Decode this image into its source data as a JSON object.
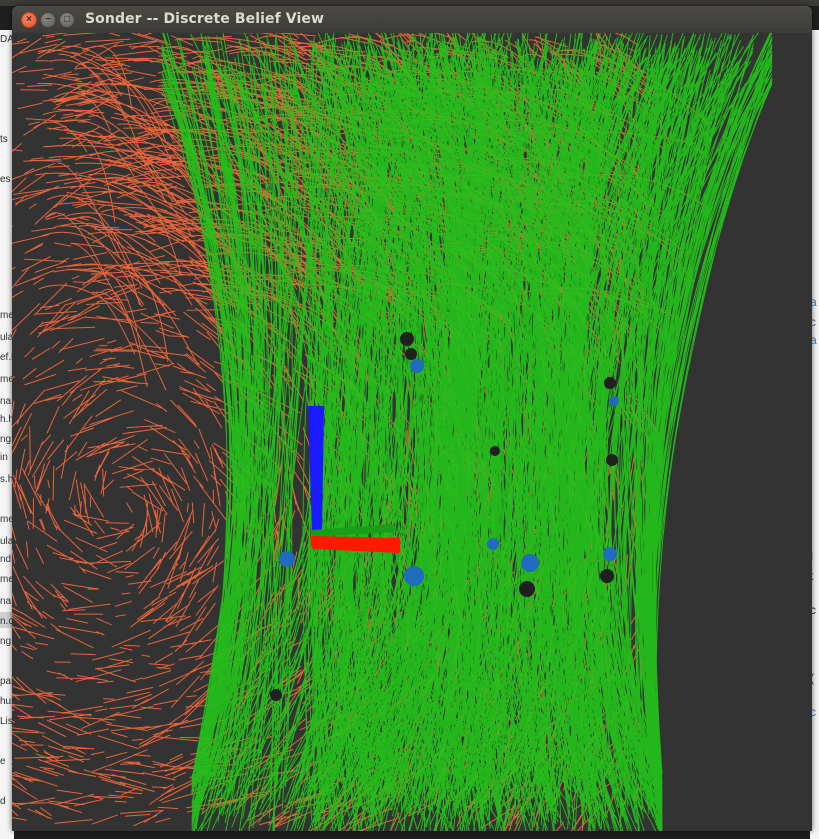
{
  "window": {
    "title": "Sonder -- Discrete Belief View",
    "close_icon": "close-icon",
    "minimize_icon": "minimize-icon",
    "maximize_icon": "maximize-icon",
    "background_color": "#333333"
  },
  "background_panels": {
    "left_fragments": [
      "DA",
      "ts",
      "es",
      "me",
      "ula",
      "ef.l",
      "me",
      "na",
      "h.h",
      "ng",
      "in",
      "s.h",
      "me",
      "ula",
      "nd",
      "me",
      "na",
      "n.c",
      "ng",
      "par",
      "hus",
      "Lis",
      "e",
      "d"
    ],
    "right_fragments": [
      "a",
      "c",
      "a",
      "I",
      "t",
      "c",
      "(",
      "c"
    ]
  },
  "scene": {
    "particle_colors": {
      "orange": "#e8643a",
      "green": "#22c21a",
      "agent_blue": "#1f6bbd",
      "obstacle_dark": "#202020"
    },
    "axis_colors": {
      "x": "#ff1a00",
      "y": "#1a9e1a",
      "z": "#1a1aff"
    }
  }
}
